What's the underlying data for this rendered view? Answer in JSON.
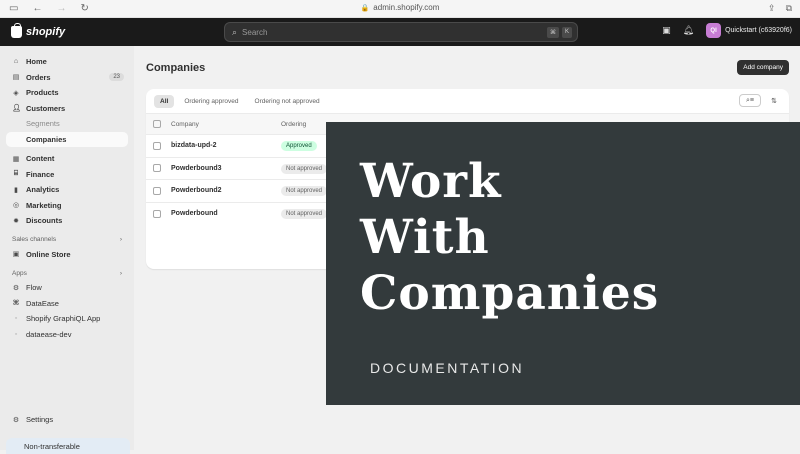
{
  "browser": {
    "url": "admin.shopify.com"
  },
  "topbar": {
    "brand": "shopify",
    "search_placeholder": "Search",
    "kbd": [
      "⌘",
      "K"
    ],
    "avatar_initials": "QI",
    "store_name": "Quickstart (c63920f6)"
  },
  "sidebar": {
    "home": "Home",
    "orders": "Orders",
    "orders_count": "23",
    "products": "Products",
    "customers": "Customers",
    "segments": "Segments",
    "companies": "Companies",
    "content": "Content",
    "finance": "Finance",
    "analytics": "Analytics",
    "marketing": "Marketing",
    "discounts": "Discounts",
    "sales_channels": "Sales channels",
    "online_store": "Online Store",
    "apps": "Apps",
    "flow": "Flow",
    "dataease": "DataEase",
    "graphiql": "Shopify GraphiQL App",
    "dataease_dev": "dataease-dev",
    "settings": "Settings",
    "non_transferable": "Non-transferable"
  },
  "main": {
    "title": "Companies",
    "add_button": "Add company",
    "tabs": [
      "All",
      "Ordering approved",
      "Ordering not approved"
    ],
    "columns": {
      "company": "Company",
      "ordering": "Ordering"
    },
    "rows": [
      {
        "company": "bizdata-upd-2",
        "ordering": "Approved",
        "approved": true
      },
      {
        "company": "Powderbound3",
        "ordering": "Not approved",
        "approved": false
      },
      {
        "company": "Powderbound2",
        "ordering": "Not approved",
        "approved": false
      },
      {
        "company": "Powderbound",
        "ordering": "Not approved",
        "approved": false
      }
    ]
  },
  "overlay": {
    "title_line1": "Work",
    "title_line2": "With",
    "title_line3": "Companies",
    "subtitle": "DOCUMENTATION"
  }
}
